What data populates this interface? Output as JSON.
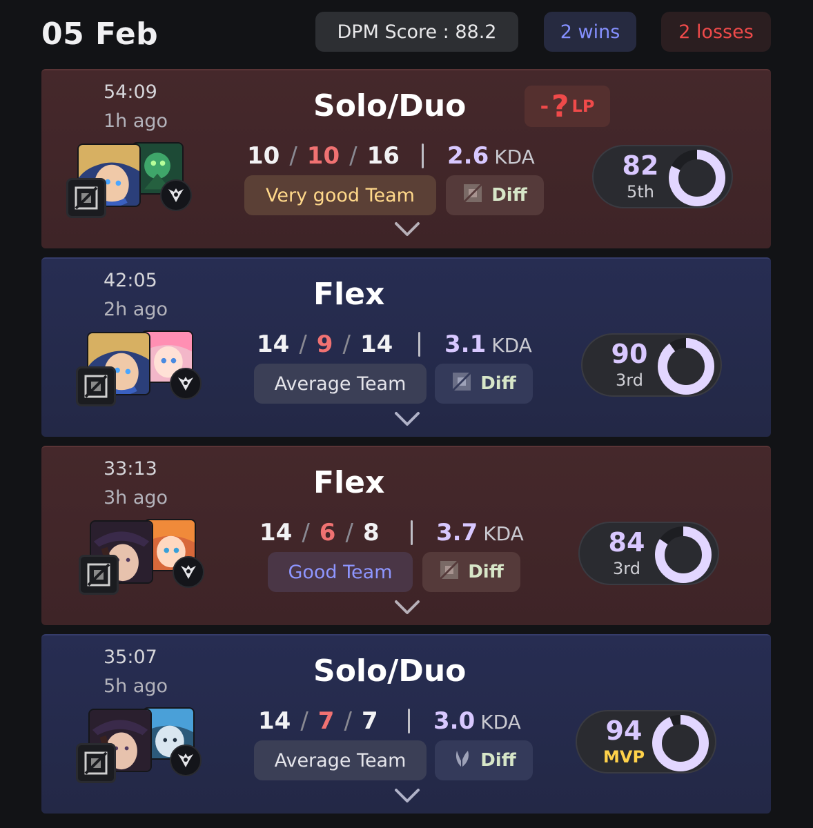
{
  "header": {
    "date": "05 Feb",
    "dpm_score": "DPM Score : 88.2",
    "wins": "2 wins",
    "losses": "2 losses"
  },
  "colors": {
    "loss_bg": "#45282b",
    "win_bg": "#272d52",
    "accent_purple": "#d9c8ff",
    "death_red": "#f07272",
    "mvp_gold": "#ffd24a"
  },
  "matches": [
    {
      "result": "loss",
      "duration": "54:09",
      "ago": "1h ago",
      "queue": "Solo/Duo",
      "lp_prefix": "- ",
      "lp_value": "?",
      "lp_unit": "LP",
      "kills": "10",
      "deaths": "10",
      "assists": "16",
      "kda": "2.6",
      "kda_unit": "KDA",
      "team_label": "Very good Team",
      "diff_label": "Diff",
      "score": "82",
      "rank": "5th",
      "icons": [
        "champion-ezreal-icon",
        "champion-thresh-icon",
        "rune-icon",
        "spell-icon",
        "chevron-down-icon"
      ]
    },
    {
      "result": "win",
      "duration": "42:05",
      "ago": "2h ago",
      "queue": "Flex",
      "kills": "14",
      "deaths": "9",
      "assists": "14",
      "kda": "3.1",
      "kda_unit": "KDA",
      "team_label": "Average Team",
      "diff_label": "Diff",
      "score": "90",
      "rank": "3rd"
    },
    {
      "result": "loss",
      "duration": "33:13",
      "ago": "3h ago",
      "queue": "Flex",
      "kills": "14",
      "deaths": "6",
      "assists": "8",
      "kda": "3.7",
      "kda_unit": "KDA",
      "team_label": "Good Team",
      "diff_label": "Diff",
      "score": "84",
      "rank": "3rd"
    },
    {
      "result": "win",
      "duration": "35:07",
      "ago": "5h ago",
      "queue": "Solo/Duo",
      "kills": "14",
      "deaths": "7",
      "assists": "7",
      "kda": "3.0",
      "kda_unit": "KDA",
      "team_label": "Average Team",
      "diff_label": "Diff",
      "score": "94",
      "rank": "MVP"
    }
  ]
}
